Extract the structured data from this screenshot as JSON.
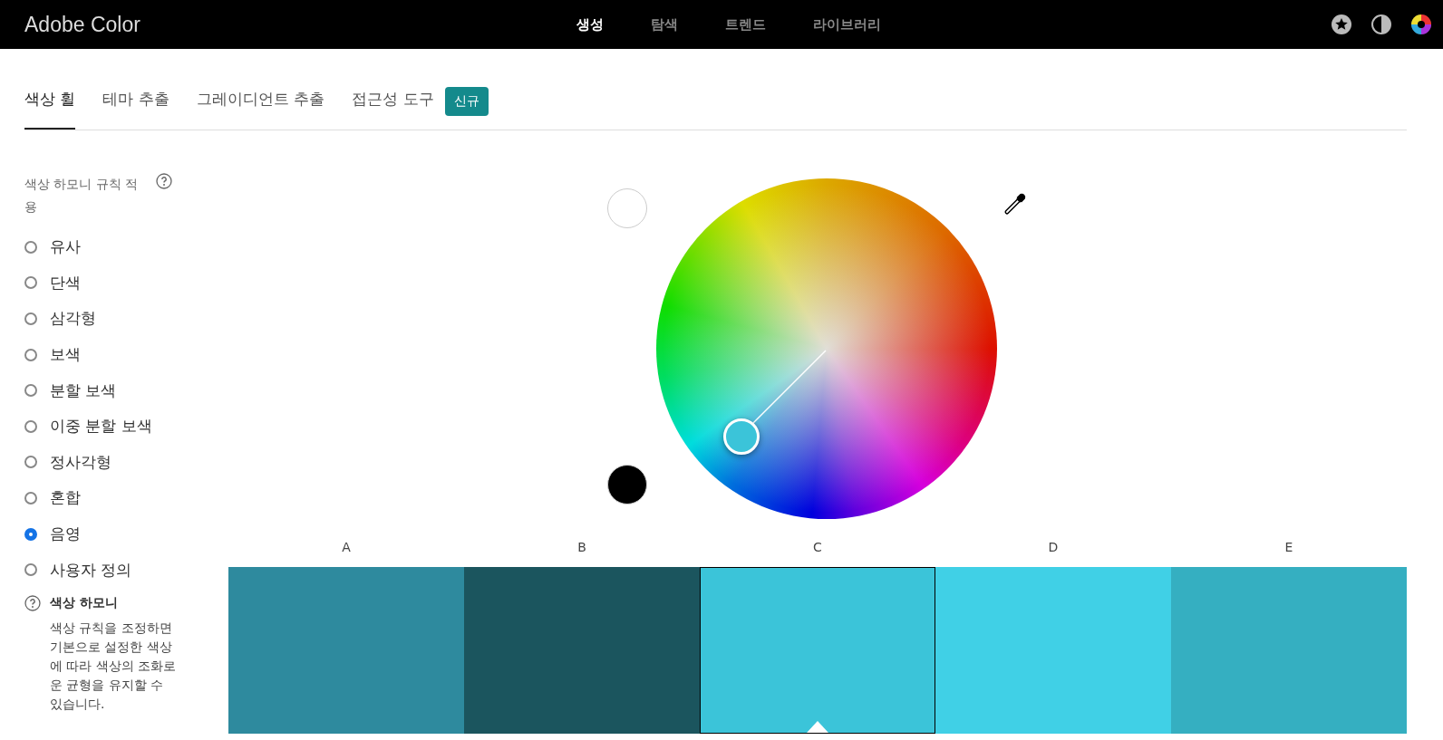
{
  "brand": "Adobe Color",
  "nav": [
    {
      "label": "생성",
      "selected": true
    },
    {
      "label": "탐색",
      "selected": false
    },
    {
      "label": "트렌드",
      "selected": false
    },
    {
      "label": "라이브러리",
      "selected": false
    }
  ],
  "tabs": [
    {
      "label": "색상 휠",
      "selected": true
    },
    {
      "label": "테마 추출",
      "selected": false
    },
    {
      "label": "그레이디언트 추출",
      "selected": false
    },
    {
      "label": "접근성 도구",
      "selected": false
    }
  ],
  "new_badge": "신규",
  "sidebar": {
    "title": "색상 하모니 규칙 적용",
    "rules": [
      {
        "label": "유사",
        "selected": false
      },
      {
        "label": "단색",
        "selected": false
      },
      {
        "label": "삼각형",
        "selected": false
      },
      {
        "label": "보색",
        "selected": false
      },
      {
        "label": "분할 보색",
        "selected": false
      },
      {
        "label": "이중 분할 보색",
        "selected": false
      },
      {
        "label": "정사각형",
        "selected": false
      },
      {
        "label": "혼합",
        "selected": false
      },
      {
        "label": "음영",
        "selected": true
      },
      {
        "label": "사용자 정의",
        "selected": false
      }
    ],
    "help_title": "색상 하모니",
    "help_text": "색상 규칙을 조정하면 기본으로 설정한 색상에 따라 색상의 조화로운 균형을 유지할 수 있습니다."
  },
  "swatches": [
    {
      "label": "A",
      "color": "#2e8a9e",
      "selected": false
    },
    {
      "label": "B",
      "color": "#1b555e",
      "selected": false
    },
    {
      "label": "C",
      "color": "#3bc4d9",
      "selected": true
    },
    {
      "label": "D",
      "color": "#40d0e6",
      "selected": false
    },
    {
      "label": "E",
      "color": "#35afc1",
      "selected": false
    }
  ]
}
